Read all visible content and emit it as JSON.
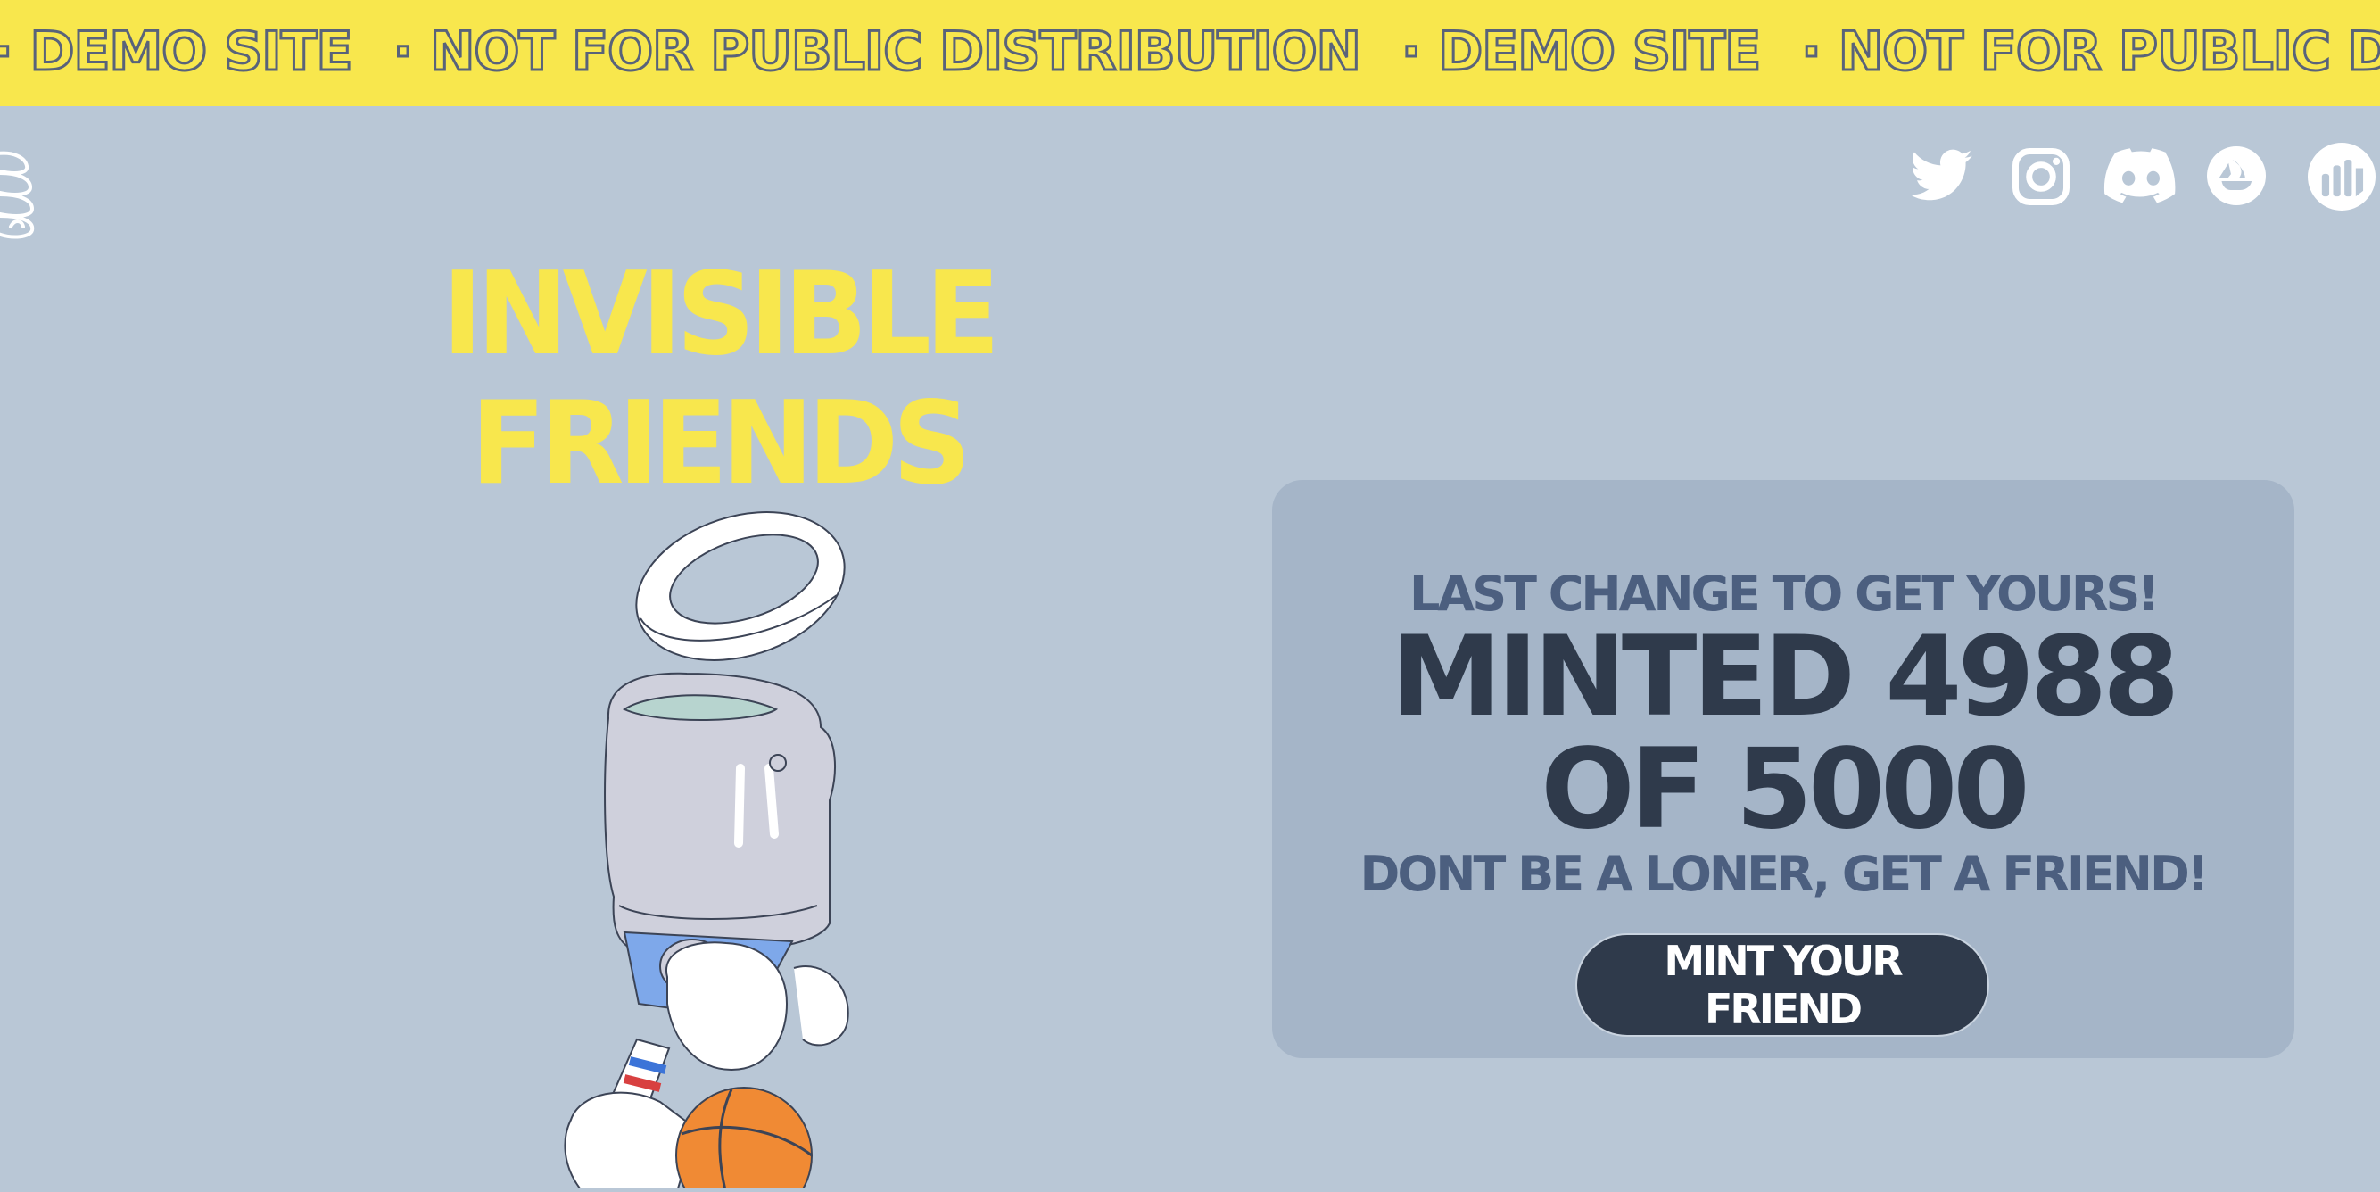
{
  "banner": {
    "items": [
      "· DEMO SITE",
      "· NOT FOR PUBLIC DISTRIBUTION",
      "· DEMO SITE",
      "· NOT FOR PUBLIC DISTRIBUTION"
    ]
  },
  "logo": {
    "icon": "logo-icon"
  },
  "socials": [
    {
      "icon": "twitter-icon"
    },
    {
      "icon": "instagram-icon"
    },
    {
      "icon": "discord-icon"
    },
    {
      "icon": "opensea-icon"
    },
    {
      "icon": "marketplace-icon"
    }
  ],
  "hero": {
    "title_line1": "INVISIBLE",
    "title_line2": "FRIENDS"
  },
  "mint": {
    "headline": "LAST CHANGE TO GET YOURS!",
    "count_text": "MINTED 4988 OF 5000",
    "minted": 4988,
    "total": 5000,
    "tagline": "DONT BE A LONER, GET A FRIEND!",
    "button_label": "MINT YOUR FRIEND"
  },
  "colors": {
    "background": "#b9c7d6",
    "banner": "#f8e74d",
    "title": "#f8e74d",
    "card": "#a5b5c8",
    "dark": "#2f3a4b",
    "muted_text": "#4c5f7f"
  }
}
